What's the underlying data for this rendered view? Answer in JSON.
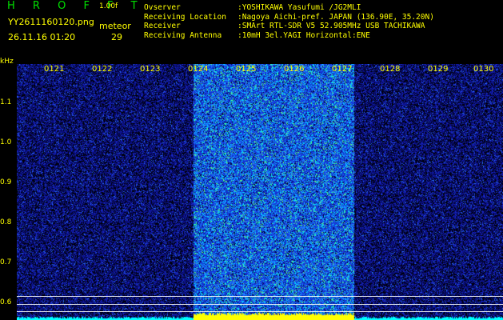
{
  "header": {
    "logo": "H R O F F T",
    "version": "1.00f",
    "filename": "YY2611160120.png",
    "datetime": "26.11.16 01:20",
    "meteor_label": "meteor",
    "meteor_count": "29"
  },
  "info": [
    {
      "key": "Ovserver",
      "value": ":YOSHIKAWA Yasufumi /JG2MLI"
    },
    {
      "key": "Receiving Location",
      "value": ":Nagoya Aichi-pref. JAPAN (136.90E, 35.20N)"
    },
    {
      "key": "Receiver",
      "value": ":SMArt RTL-SDR V5 52.905MHz USB TACHIKAWA"
    },
    {
      "key": "Receiving Antenna",
      "value": ":10mH 3el.YAGI Horizontal:ENE"
    }
  ],
  "axis": {
    "y_unit": "kHz",
    "y_ticks": [
      "1.1",
      "1.0",
      "0.9",
      "0.8",
      "0.7",
      "0.6"
    ],
    "x_ticks": [
      "0121",
      "0122",
      "0123",
      "0124",
      "0125",
      "0126",
      "0127",
      "0128",
      "0129",
      "0130"
    ]
  },
  "colors": {
    "background": "#000000",
    "text_green": "#00e000",
    "text_yellow": "#ffff00",
    "noise_blue": "#1a2ad0",
    "noise_cyan": "#00ffff",
    "noise_green": "#40ff40",
    "burst_yellow": "#ffff00"
  }
}
